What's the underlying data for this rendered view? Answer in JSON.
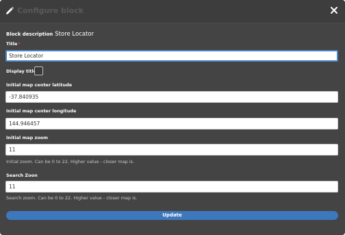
{
  "dialog": {
    "title": "Configure block",
    "close_icon": "close-icon",
    "title_icon": "pencil-icon"
  },
  "block_description": {
    "label": "Block description",
    "value": "Store Locator"
  },
  "fields": {
    "title": {
      "label": "Title",
      "required_mark": "*",
      "value": "Store Locator"
    },
    "display_title": {
      "label": "Display title",
      "checked": false
    },
    "latitude": {
      "label": "Initial map center latitude",
      "value": "-37.840935"
    },
    "longitude": {
      "label": "Initial map center longitude",
      "value": "144.946457"
    },
    "zoom": {
      "label": "Initial map zoom",
      "value": "11",
      "help": "Initial zoom. Can be 0 to 22. Higher value - closer map is."
    },
    "search_zoom": {
      "label": "Search Zoon",
      "value": "11",
      "help": "Search zoom. Can be 0 to 22. Higher value - closer map is."
    }
  },
  "actions": {
    "update_label": "Update"
  },
  "colors": {
    "dialog_bg": "#444444",
    "titlebar_bg": "#3d3d3d",
    "accent": "#3d78bd",
    "focus_border": "#4a87c9",
    "required": "#e04848"
  }
}
